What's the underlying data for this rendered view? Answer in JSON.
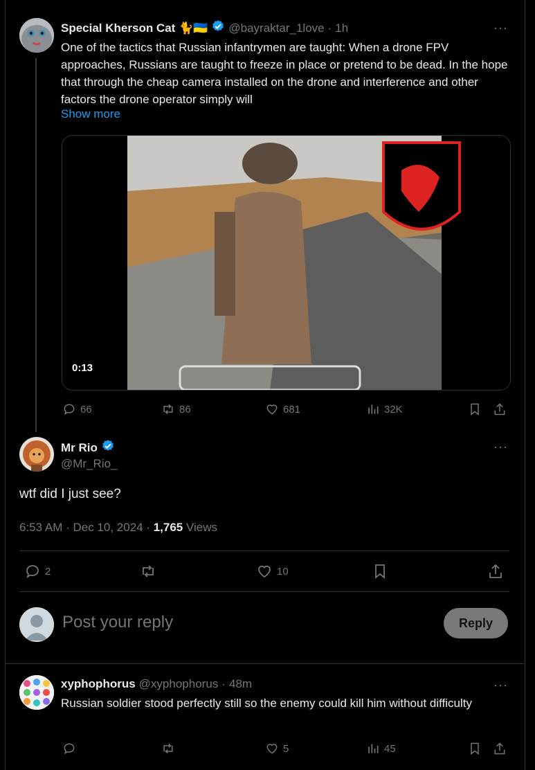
{
  "tweet1": {
    "name": "Special Kherson Cat 🐈🇺🇦",
    "handle": "@bayraktar_1love",
    "time": "1h",
    "text": "One of the tactics that Russian infantrymen are taught: When a drone FPV approaches, Russians are taught to freeze in place or pretend to be dead. In the hope that through the cheap camera installed on the drone and interference and other factors the drone operator simply will",
    "show_more": "Show more",
    "video_duration": "0:13",
    "replies": "66",
    "reposts": "86",
    "likes": "681",
    "views": "32K"
  },
  "main": {
    "name": "Mr Rio",
    "handle": "@Mr_Rio_",
    "text": "wtf did I just see?",
    "timestamp": "6:53 AM · Dec 10, 2024 · ",
    "view_count": "1,765",
    "views_label": " Views",
    "replies": "2",
    "likes": "10"
  },
  "composer": {
    "placeholder": "Post your reply",
    "button": "Reply"
  },
  "reply1": {
    "name": "xyphophorus",
    "handle": "@xyphophorus",
    "time": "48m",
    "text": "Russian soldier stood perfectly still so the enemy could kill him without difficulty",
    "likes": "5",
    "views": "45"
  },
  "colors": {
    "accent": "#1d9bf0",
    "background": "#000000",
    "border": "#2f3336",
    "muted": "#71767b"
  }
}
